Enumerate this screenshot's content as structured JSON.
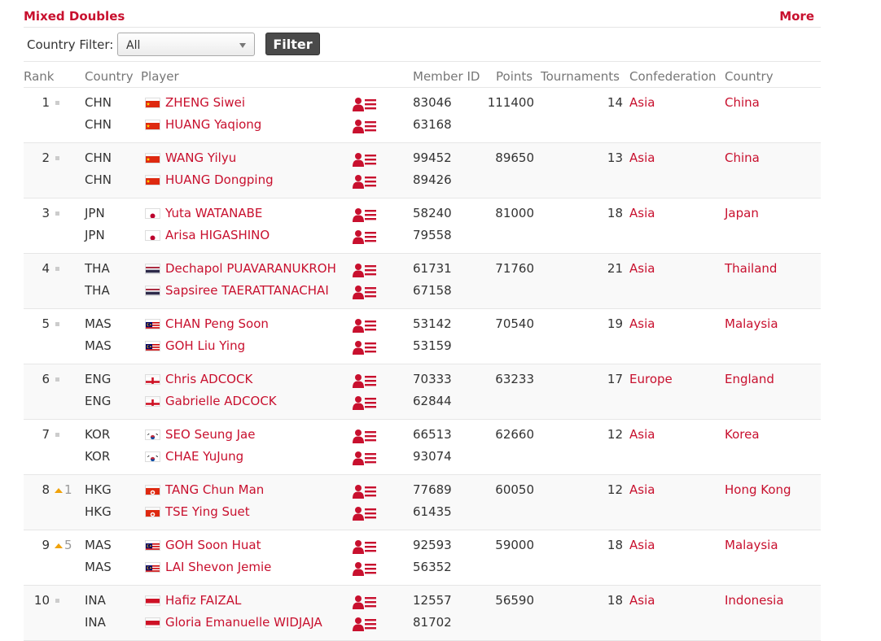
{
  "header": {
    "title": "Mixed Doubles",
    "more_label": "More"
  },
  "filter": {
    "label": "Country Filter:",
    "selected": "All",
    "button_label": "Filter"
  },
  "columns": {
    "rank": "Rank",
    "country_code": "Country",
    "player": "Player",
    "member_id": "Member ID",
    "points": "Points",
    "tournaments": "Tournaments",
    "confederation": "Confederation",
    "country": "Country"
  },
  "rows": [
    {
      "rank": "1",
      "movement": "",
      "points": "111400",
      "tournaments": "14",
      "confederation": "Asia",
      "country": "China",
      "players": [
        {
          "code": "CHN",
          "flag": "chn",
          "name": "ZHENG Siwei",
          "member_id": "83046"
        },
        {
          "code": "CHN",
          "flag": "chn",
          "name": "HUANG Yaqiong",
          "member_id": "63168"
        }
      ]
    },
    {
      "rank": "2",
      "movement": "",
      "points": "89650",
      "tournaments": "13",
      "confederation": "Asia",
      "country": "China",
      "players": [
        {
          "code": "CHN",
          "flag": "chn",
          "name": "WANG Yilyu",
          "member_id": "99452"
        },
        {
          "code": "CHN",
          "flag": "chn",
          "name": "HUANG Dongping",
          "member_id": "89426"
        }
      ]
    },
    {
      "rank": "3",
      "movement": "",
      "points": "81000",
      "tournaments": "18",
      "confederation": "Asia",
      "country": "Japan",
      "players": [
        {
          "code": "JPN",
          "flag": "jpn",
          "name": "Yuta WATANABE",
          "member_id": "58240"
        },
        {
          "code": "JPN",
          "flag": "jpn",
          "name": "Arisa HIGASHINO",
          "member_id": "79558"
        }
      ]
    },
    {
      "rank": "4",
      "movement": "",
      "points": "71760",
      "tournaments": "21",
      "confederation": "Asia",
      "country": "Thailand",
      "players": [
        {
          "code": "THA",
          "flag": "tha",
          "name": "Dechapol PUAVARANUKROH",
          "member_id": "61731"
        },
        {
          "code": "THA",
          "flag": "tha",
          "name": "Sapsiree TAERATTANACHAI",
          "member_id": "67158"
        }
      ]
    },
    {
      "rank": "5",
      "movement": "",
      "points": "70540",
      "tournaments": "19",
      "confederation": "Asia",
      "country": "Malaysia",
      "players": [
        {
          "code": "MAS",
          "flag": "mas",
          "name": "CHAN Peng Soon",
          "member_id": "53142"
        },
        {
          "code": "MAS",
          "flag": "mas",
          "name": "GOH Liu Ying",
          "member_id": "53159"
        }
      ]
    },
    {
      "rank": "6",
      "movement": "",
      "points": "63233",
      "tournaments": "17",
      "confederation": "Europe",
      "country": "England",
      "players": [
        {
          "code": "ENG",
          "flag": "eng",
          "name": "Chris ADCOCK",
          "member_id": "70333"
        },
        {
          "code": "ENG",
          "flag": "eng",
          "name": "Gabrielle ADCOCK",
          "member_id": "62844"
        }
      ]
    },
    {
      "rank": "7",
      "movement": "",
      "points": "62660",
      "tournaments": "12",
      "confederation": "Asia",
      "country": "Korea",
      "players": [
        {
          "code": "KOR",
          "flag": "kor",
          "name": "SEO Seung Jae",
          "member_id": "66513"
        },
        {
          "code": "KOR",
          "flag": "kor",
          "name": "CHAE YuJung",
          "member_id": "93074"
        }
      ]
    },
    {
      "rank": "8",
      "movement": "1",
      "points": "60050",
      "tournaments": "12",
      "confederation": "Asia",
      "country": "Hong Kong",
      "players": [
        {
          "code": "HKG",
          "flag": "hkg",
          "name": "TANG Chun Man",
          "member_id": "77689"
        },
        {
          "code": "HKG",
          "flag": "hkg",
          "name": "TSE Ying Suet",
          "member_id": "61435"
        }
      ]
    },
    {
      "rank": "9",
      "movement": "5",
      "points": "59000",
      "tournaments": "18",
      "confederation": "Asia",
      "country": "Malaysia",
      "players": [
        {
          "code": "MAS",
          "flag": "mas",
          "name": "GOH Soon Huat",
          "member_id": "92593"
        },
        {
          "code": "MAS",
          "flag": "mas",
          "name": "LAI Shevon Jemie",
          "member_id": "56352"
        }
      ]
    },
    {
      "rank": "10",
      "movement": "",
      "points": "56590",
      "tournaments": "18",
      "confederation": "Asia",
      "country": "Indonesia",
      "players": [
        {
          "code": "INA",
          "flag": "ina",
          "name": "Hafiz FAIZAL",
          "member_id": "12557"
        },
        {
          "code": "INA",
          "flag": "ina",
          "name": "Gloria Emanuelle WIDJAJA",
          "member_id": "81702"
        }
      ]
    }
  ],
  "colors": {
    "accent": "#c8102e",
    "rank_up": "#f0a20a",
    "muted": "#777777"
  }
}
